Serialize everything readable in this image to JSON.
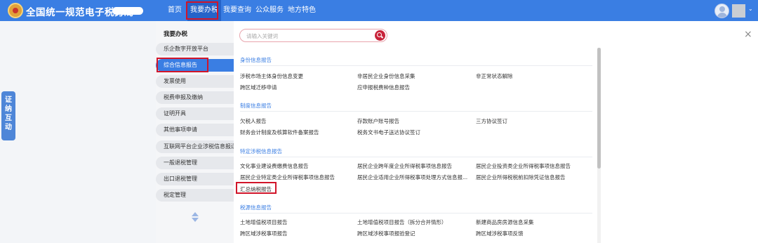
{
  "header": {
    "site_title": "全国统一规范电子税务局",
    "nav": [
      "首页",
      "我要办税",
      "我要查询",
      "公众服务",
      "地方特色"
    ],
    "active_nav": "我要办税"
  },
  "float_tab": "证纳互动",
  "sidebar": {
    "heading": "我要办税",
    "items": [
      "乐企数字开放平台",
      "综合信息报告",
      "发票使用",
      "税费申报及缴纳",
      "证明开具",
      "其他事项申请",
      "互联网平台企业涉税信息报送",
      "一般退税管理",
      "出口退税管理",
      "税定管理"
    ],
    "active": "综合信息报告"
  },
  "search": {
    "placeholder": "请输入关键词"
  },
  "sections": [
    {
      "title": "身份信息报告",
      "items": [
        "涉税市场主体身份信息变更",
        "非居民企业身份信息采集",
        "非正常状态解除",
        "跨区域迁移申请",
        "应申报税费种信息报告"
      ]
    },
    {
      "title": "制度信息报告",
      "items": [
        "欠税人报告",
        "存款账户账号报告",
        "三方协议签订",
        "财务会计制度及核算软件备案报告",
        "税务文书电子送达协议签订"
      ]
    },
    {
      "title": "特定涉税信息报告",
      "items": [
        "文化事业建设费缴费信息报告",
        "居民企业跨年度企业所得税事项信息报告",
        "居民企业投资类企业所得税事项信息报告",
        "居民企业特定类企业所得税事项信息报告",
        "居民企业适用企业所得税事项处理方式信息报...",
        "居民企业所得税税前扣除凭证信息报告",
        "汇总纳税报告"
      ]
    },
    {
      "title": "税源信息报告",
      "items": [
        "土地增值税项目报告",
        "土地增值税项目报告（拆分合并情形）",
        "新建商品房房源信息采集",
        "跨区域涉税事项报告",
        "跨区域涉税事项报验登记",
        "跨区域涉税事项反馈"
      ]
    }
  ],
  "colors": {
    "header": "#3a7ee3",
    "highlight": "#d1152a",
    "search_button": "#c8233a"
  }
}
